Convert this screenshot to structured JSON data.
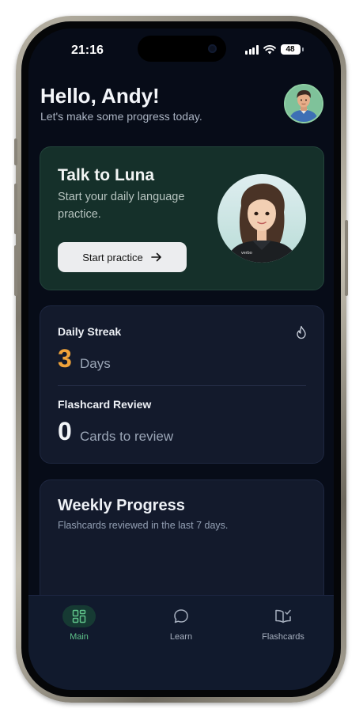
{
  "status_bar": {
    "time": "21:16",
    "battery": "48"
  },
  "header": {
    "greeting": "Hello, Andy!",
    "subtitle": "Let's make some progress today."
  },
  "luna_card": {
    "title": "Talk to Luna",
    "subtitle": "Start your daily language practice.",
    "button_label": "Start practice",
    "shirt_text": "verbo"
  },
  "stats": {
    "streak_label": "Daily Streak",
    "streak_value": "3",
    "streak_unit": "Days",
    "review_label": "Flashcard Review",
    "review_value": "0",
    "review_unit": "Cards to review"
  },
  "weekly": {
    "title": "Weekly Progress",
    "subtitle": "Flashcards reviewed in the last 7 days."
  },
  "tabs": [
    {
      "label": "Main",
      "icon": "grid-icon",
      "active": true
    },
    {
      "label": "Learn",
      "icon": "chat-bubble-icon",
      "active": false
    },
    {
      "label": "Flashcards",
      "icon": "book-check-icon",
      "active": false
    }
  ],
  "colors": {
    "background": "#070c18",
    "luna_card": "#15302a",
    "card": "#131a2c",
    "streak_accent": "#f0a33a",
    "tab_active": "#5fc38a"
  }
}
